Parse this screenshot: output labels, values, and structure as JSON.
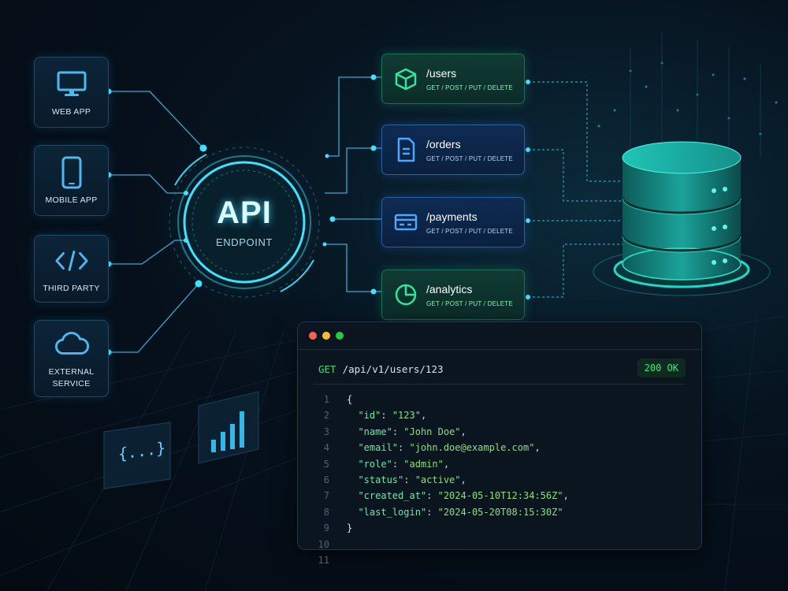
{
  "center": {
    "title": "API",
    "subtitle": "ENDPOINT"
  },
  "clients": [
    {
      "label": "WEB APP",
      "icon": "monitor-icon"
    },
    {
      "label": "MOBILE APP",
      "icon": "phone-icon"
    },
    {
      "label": "THIRD PARTY",
      "icon": "code-brackets-icon"
    },
    {
      "label": "EXTERNAL\nSERVICE",
      "icon": "cloud-icon"
    }
  ],
  "endpoints": [
    {
      "path": "/users",
      "methods": "GET / POST / PUT / DELETE",
      "icon": "cube-icon",
      "accent": "#2ee6a0"
    },
    {
      "path": "/orders",
      "methods": "GET / POST / PUT / DELETE",
      "icon": "document-icon",
      "accent": "#4aa8ff"
    },
    {
      "path": "/payments",
      "methods": "GET / POST / PUT / DELETE",
      "icon": "card-icon",
      "accent": "#4aa8ff"
    },
    {
      "path": "/analytics",
      "methods": "GET / POST / PUT / DELETE",
      "icon": "pie-chart-icon",
      "accent": "#2ee6a0"
    }
  ],
  "database": {
    "icon": "database-icon",
    "accent": "#1fe0c8"
  },
  "decorations": {
    "json_card": "{...}",
    "json_card_icon": "braces-icon",
    "bar_card_icon": "bar-chart-icon"
  },
  "terminal": {
    "window_dots": [
      "#ff5f56",
      "#ffbd2e",
      "#27c93f"
    ],
    "method": "GET",
    "path": "/api/v1/users/123",
    "status": "200 OK",
    "lines": [
      {
        "num": "1",
        "text": "{"
      },
      {
        "num": "2",
        "key": "\"id\"",
        "value": "\"123\"",
        "trail": ","
      },
      {
        "num": "3",
        "key": "\"name\"",
        "value": "\"John Doe\"",
        "trail": ","
      },
      {
        "num": "4",
        "key": "\"email\"",
        "value": "\"john.doe@example.com\"",
        "trail": ","
      },
      {
        "num": "5",
        "key": "\"role\"",
        "value": "\"admin\"",
        "trail": ","
      },
      {
        "num": "6",
        "key": "\"status\"",
        "value": "\"active\"",
        "trail": ","
      },
      {
        "num": "7",
        "key": "\"created_at\"",
        "value": "\"2024-05-10T12:34:56Z\"",
        "trail": ","
      },
      {
        "num": "8",
        "key": "\"last_login\"",
        "value": "\"2024-05-20T08:15:30Z\"",
        "trail": ""
      },
      {
        "num": "9",
        "text": "}"
      },
      {
        "num": "10",
        "text": ""
      },
      {
        "num": "11",
        "text": ""
      }
    ]
  }
}
